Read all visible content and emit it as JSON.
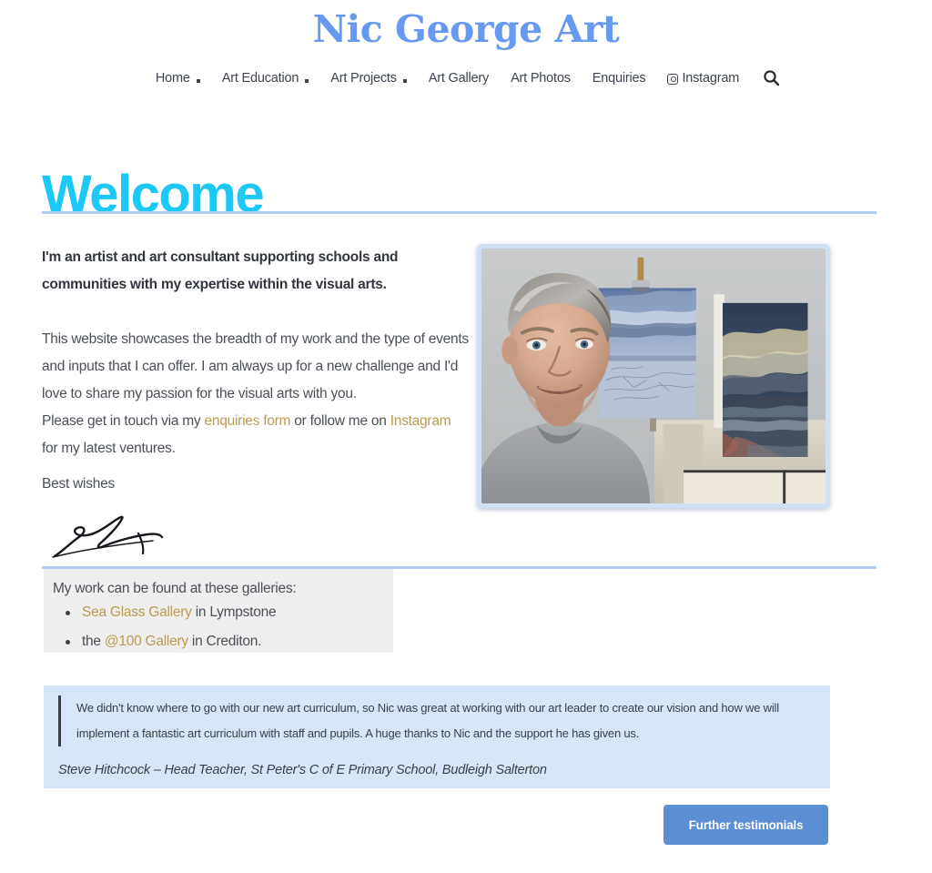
{
  "site": {
    "title": "Nic George Art"
  },
  "nav": {
    "items": [
      {
        "label": "Home",
        "has_dropdown": true
      },
      {
        "label": "Art Education",
        "has_dropdown": true
      },
      {
        "label": "Art Projects",
        "has_dropdown": true
      },
      {
        "label": "Art Gallery",
        "has_dropdown": false
      },
      {
        "label": "Art Photos",
        "has_dropdown": false
      },
      {
        "label": "Enquiries",
        "has_dropdown": false
      },
      {
        "label": "Instagram",
        "has_dropdown": false,
        "icon": "instagram-icon"
      }
    ],
    "search_icon": "search-icon"
  },
  "main": {
    "heading": "Welcome",
    "lead": "I'm an artist and art consultant supporting schools and communities with my expertise within the visual arts.",
    "para_1_part_1": "This website showcases the breadth of my work and the type of events and inputs that I can offer. I am always up for a new challenge and I'd love to share my passion for the visual arts with you.",
    "para_2_part_1": "Please get in touch via my ",
    "link_enquiries": "enquiries form",
    "para_2_part_2": " or follow me on ",
    "link_instagram": "Instagram",
    "para_2_part_3": " for my latest ventures.",
    "best_wishes": "Best wishes",
    "signature_alt": "signature"
  },
  "photo": {
    "alt": "Nic George seated in front of two seascape paintings"
  },
  "galleries": {
    "heading": "My work can be found at these galleries:",
    "items": [
      {
        "link": "Sea Glass Gallery",
        "prefix": "",
        "suffix": " in Lympstone"
      },
      {
        "link": "@100 Gallery",
        "prefix": "the ",
        "suffix": " in Crediton."
      }
    ]
  },
  "testimonial": {
    "quote": "We didn't know where to go with our new art curriculum, so Nic was great at working with our art leader to create our vision and how we will implement a fantastic art curriculum with staff and pupils. A huge thanks to Nic and the support he has given us.",
    "attribution": "Steve Hitchcock – Head Teacher, St Peter's C of E Primary School, Budleigh Salterton"
  },
  "actions": {
    "further_testimonials": "Further testimonials"
  },
  "colors": {
    "title_blue": "#6699f0",
    "heading_cyan": "#1cc8f5",
    "rule_blue": "#aecdf0",
    "link_gold": "#bb9a52",
    "testimonial_bg": "#d6e5f8",
    "button_blue": "#5b8fd4",
    "gallery_bg": "#efefef"
  }
}
